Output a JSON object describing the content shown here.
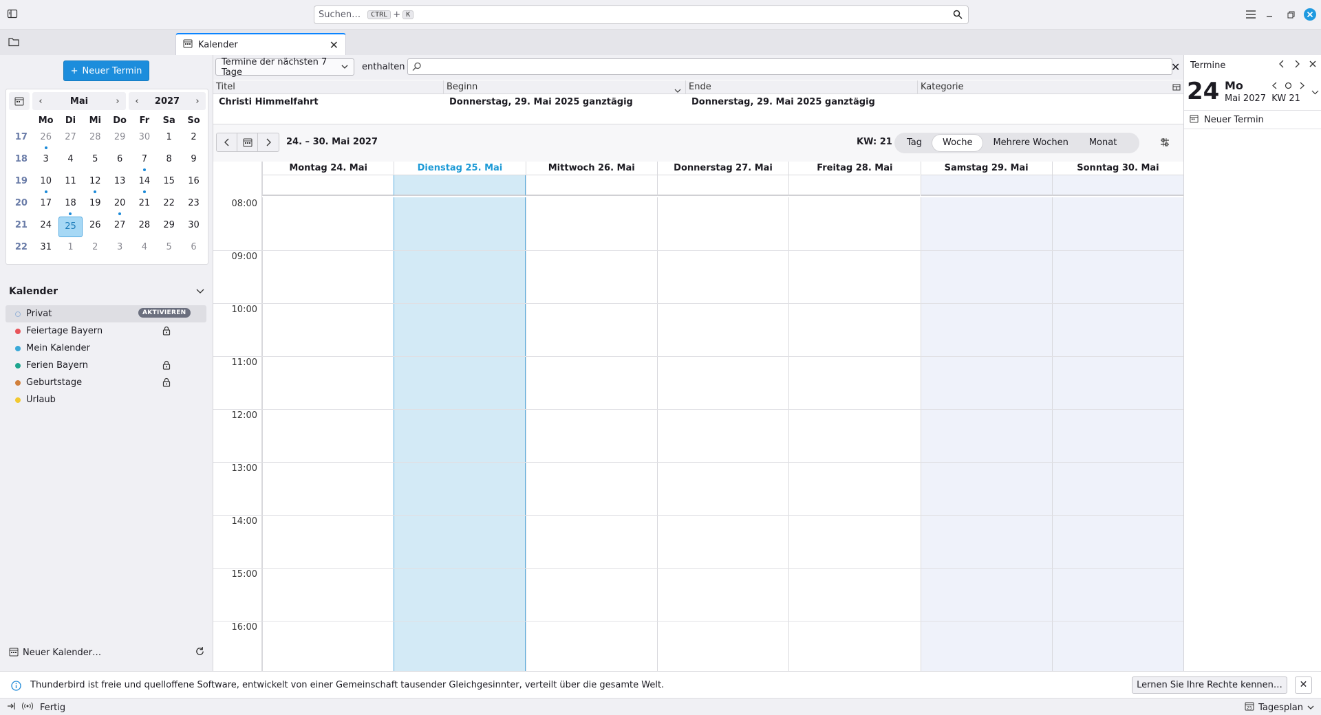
{
  "search": {
    "placeholder": "Suchen…",
    "kbd1": "CTRL",
    "plus": "+",
    "kbd2": "K"
  },
  "tab": {
    "label": "Kalender"
  },
  "left": {
    "new_event": "Neuer Termin",
    "minimonth": {
      "month": "Mai",
      "year": "2027",
      "weekday_headers": [
        "Mo",
        "Di",
        "Mi",
        "Do",
        "Fr",
        "Sa",
        "So"
      ],
      "weeks": [
        {
          "wk": "17",
          "days": [
            "26",
            "27",
            "28",
            "29",
            "30",
            "1",
            "2"
          ]
        },
        {
          "wk": "18",
          "days": [
            "3",
            "4",
            "5",
            "6",
            "7",
            "8",
            "9"
          ]
        },
        {
          "wk": "19",
          "days": [
            "10",
            "11",
            "12",
            "13",
            "14",
            "15",
            "16"
          ]
        },
        {
          "wk": "20",
          "days": [
            "17",
            "18",
            "19",
            "20",
            "21",
            "22",
            "23"
          ]
        },
        {
          "wk": "21",
          "days": [
            "24",
            "25",
            "26",
            "27",
            "28",
            "29",
            "30"
          ]
        },
        {
          "wk": "22",
          "days": [
            "31",
            "1",
            "2",
            "3",
            "4",
            "5",
            "6"
          ]
        }
      ]
    },
    "calendars_title": "Kalender",
    "calendars": [
      {
        "name": "Privat",
        "color": "#9bb5d8",
        "badge": "AKTIVIEREN"
      },
      {
        "name": "Feiertage Bayern",
        "color": "#e8545a",
        "locked": true
      },
      {
        "name": "Mein Kalender",
        "color": "#3ba9d8"
      },
      {
        "name": "Ferien Bayern",
        "color": "#1da58e",
        "locked": true
      },
      {
        "name": "Geburtstage",
        "color": "#d1803c",
        "locked": true
      },
      {
        "name": "Urlaub",
        "color": "#f2c930"
      }
    ],
    "new_calendar": "Neuer Kalender…"
  },
  "unifinder": {
    "filter": "Termine der nächsten 7 Tage",
    "contains": "enthalten",
    "columns": [
      "Titel",
      "Beginn",
      "Ende",
      "Kategorie"
    ],
    "rows": [
      {
        "title": "Christi Himmelfahrt",
        "start": "Donnerstag, 29. Mai 2025 ganztägig",
        "end": "Donnerstag, 29. Mai 2025 ganztägig",
        "category": ""
      }
    ]
  },
  "view": {
    "range": "24. – 30. Mai 2027",
    "kw": "KW: 21",
    "tabs": [
      "Tag",
      "Woche",
      "Mehrere Wochen",
      "Monat"
    ],
    "active_tab": "Woche",
    "days": [
      {
        "label": "Montag 24. Mai"
      },
      {
        "label": "Dienstag 25. Mai",
        "today": true
      },
      {
        "label": "Mittwoch 26. Mai"
      },
      {
        "label": "Donnerstag 27. Mai"
      },
      {
        "label": "Freitag 28. Mai"
      },
      {
        "label": "Samstag 29. Mai",
        "weekend": true
      },
      {
        "label": "Sonntag 30. Mai",
        "weekend": true
      }
    ],
    "hours": [
      "08:00",
      "09:00",
      "10:00",
      "11:00",
      "12:00",
      "13:00",
      "14:00",
      "15:00",
      "16:00"
    ]
  },
  "right": {
    "title": "Termine",
    "day": "24",
    "weekday": "Mo",
    "month_year": "Mai 2027",
    "kw": "KW 21",
    "new_event": "Neuer Termin"
  },
  "notification": {
    "text": "Thunderbird ist freie und quelloffene Software, entwickelt von einer Gemeinschaft tausender Gleichgesinnter, verteilt über die gesamte Welt.",
    "button": "Lernen Sie Ihre Rechte kennen…"
  },
  "status": {
    "text": "Fertig",
    "mode": "Tagesplan"
  }
}
